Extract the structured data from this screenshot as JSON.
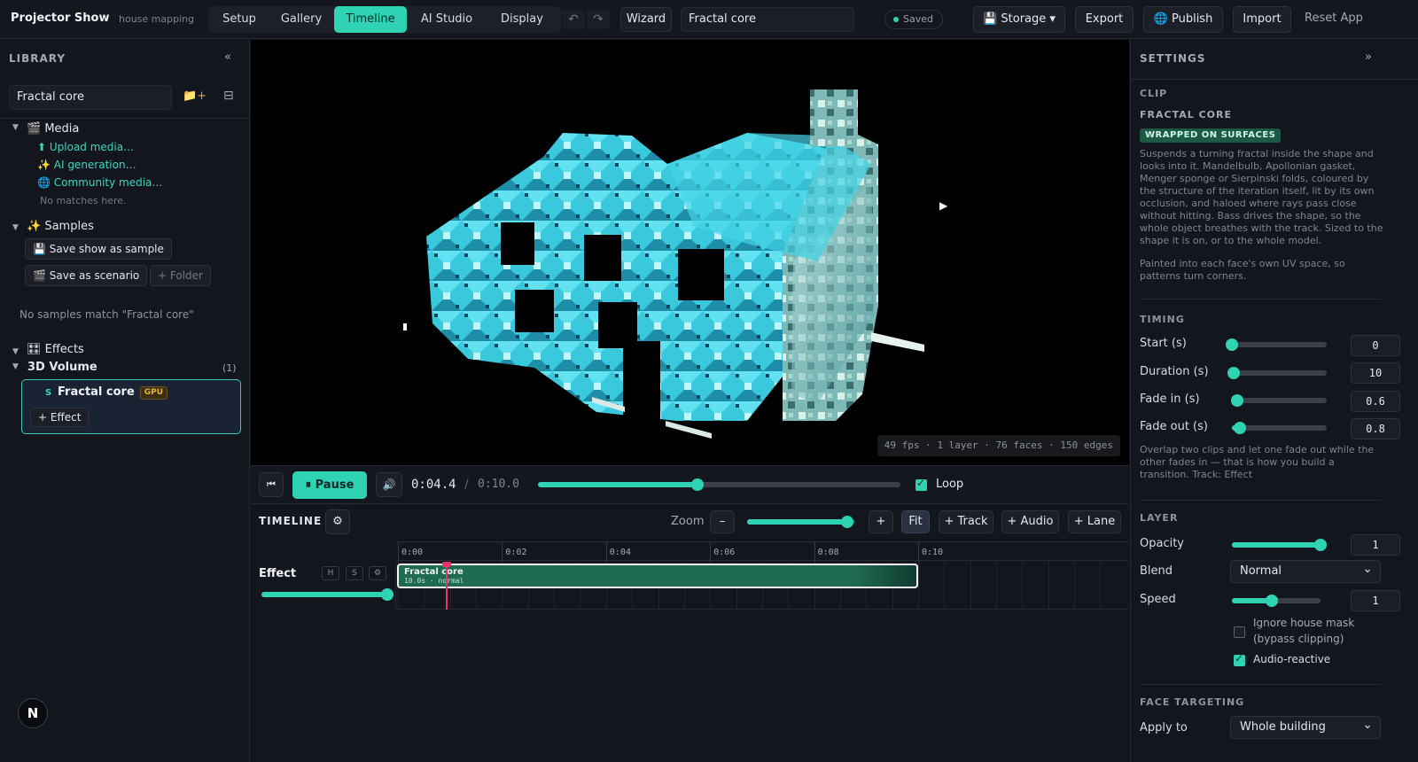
{
  "header": {
    "brand": "Projector Show",
    "subtitle": "house mapping",
    "tabs": [
      {
        "label": "Setup"
      },
      {
        "label": "Gallery"
      },
      {
        "label": "Timeline"
      },
      {
        "label": "AI Studio"
      },
      {
        "label": "Display"
      }
    ],
    "active_tab": "Timeline",
    "undo_icon": "undo-icon",
    "redo_icon": "redo-icon",
    "wizard": "Wizard",
    "project_name": "Fractal core",
    "saved": "Saved",
    "storage": "💾 Storage ▾",
    "export": "Export",
    "publish": "🌐 Publish",
    "import": "Import",
    "reset": "Reset App"
  },
  "library": {
    "title": "LIBRARY",
    "collapse": "«",
    "search_value": "Fractal core",
    "new_folder": "📁+",
    "grid_toggle": "⊟",
    "media": {
      "label": "🎬 Media",
      "upload": "⬆ Upload media…",
      "ai": "✨ AI generation…",
      "community": "🌐 Community media…",
      "no_matches": "No matches here."
    },
    "samples": {
      "label": "✨ Samples",
      "save_sample": "💾 Save show as sample",
      "save_scenario": "🎬 Save as scenario",
      "folder": "+ Folder",
      "no_match": "No samples match \"Fractal core\""
    },
    "effects": {
      "label": "🎛 Effects",
      "group": "3D Volume",
      "count": "(1)",
      "item_tag": "S",
      "item_name": "Fractal core",
      "gpu": "GPU",
      "add_effect": "+ Effect"
    },
    "avatar": "N"
  },
  "stage": {
    "stats": "49 fps · 1 layer · 76 faces · 150 edges"
  },
  "transport": {
    "rewind_icon": "rewind-icon",
    "pause": "⏸ Pause",
    "volume_icon": "volume-icon",
    "current_time": "0:04.4",
    "separator": "/",
    "total_time": "0:10.0",
    "progress": 0.44,
    "loop": "Loop",
    "loop_checked": true
  },
  "timeline": {
    "title": "TIMELINE",
    "settings_icon": "gear-icon",
    "zoom_label": "Zoom",
    "zoom_minus": "–",
    "zoom_plus": "+",
    "zoom_level": 0.93,
    "fit": "Fit",
    "add_track": "+ Track",
    "add_audio": "+ Audio",
    "add_lane": "+ Lane",
    "ruler": [
      "0:00",
      "0:02",
      "0:04",
      "0:06",
      "0:08",
      "0:10"
    ],
    "track": {
      "name": "Effect",
      "h": "H",
      "s": "S",
      "gear": "⚙",
      "volume": 1.0,
      "clip_name": "Fractal core",
      "clip_meta": "10.0s · normal"
    },
    "playhead_time": 4.4
  },
  "settings": {
    "title": "SETTINGS",
    "expand": "»",
    "clip_section": "CLIP",
    "clip_name": "FRACTAL CORE",
    "mode_badge": "WRAPPED ON SURFACES",
    "description": "Suspends a turning fractal inside the shape and looks into it. Mandelbulb, Apollonian gasket, Menger sponge or Sierpinski folds, coloured by the structure of the iteration itself, lit by its own occlusion, and haloed where rays pass close without hitting. Bass drives the shape, so the whole object breathes with the track. Sized to the shape it is on, or to the whole model.",
    "note": "Painted into each face's own UV space, so patterns turn corners.",
    "timing": {
      "title": "TIMING",
      "start_label": "Start (s)",
      "start": "0",
      "start_frac": 0.0,
      "duration_label": "Duration (s)",
      "duration": "10",
      "duration_frac": 0.02,
      "fade_in_label": "Fade in (s)",
      "fade_in": "0.6",
      "fade_in_frac": 0.06,
      "fade_out_label": "Fade out (s)",
      "fade_out": "0.8",
      "fade_out_frac": 0.08,
      "hint": "Overlap two clips and let one fade out while the other fades in — that is how you build a transition. Track: Effect"
    },
    "layer": {
      "title": "LAYER",
      "opacity_label": "Opacity",
      "opacity": "1",
      "opacity_frac": 1.0,
      "blend_label": "Blend",
      "blend": "Normal",
      "speed_label": "Speed",
      "speed": "1",
      "speed_frac": 0.45,
      "ignore_mask": "Ignore house mask",
      "ignore_mask_sub": "(bypass clipping)",
      "ignore_mask_checked": false,
      "audio_reactive": "Audio-reactive",
      "audio_reactive_checked": true
    },
    "face": {
      "title": "FACE TARGETING",
      "apply_label": "Apply to",
      "apply_value": "Whole building"
    }
  }
}
